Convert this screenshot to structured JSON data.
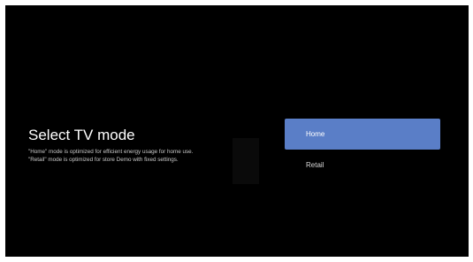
{
  "page": {
    "title": "Select TV mode",
    "description_lines": [
      "\"Home\" mode is optimized for efficient energy usage for home use.",
      "\"Retail\" mode is optimized for store Demo with fixed settings."
    ]
  },
  "options": [
    {
      "label": "Home",
      "state": "focused"
    },
    {
      "label": "Retail",
      "state": "normal"
    }
  ],
  "colors": {
    "background": "#000000",
    "focus_highlight": "#5a7ec7",
    "text_primary": "#ffffff",
    "text_secondary": "#c9c9c9"
  }
}
